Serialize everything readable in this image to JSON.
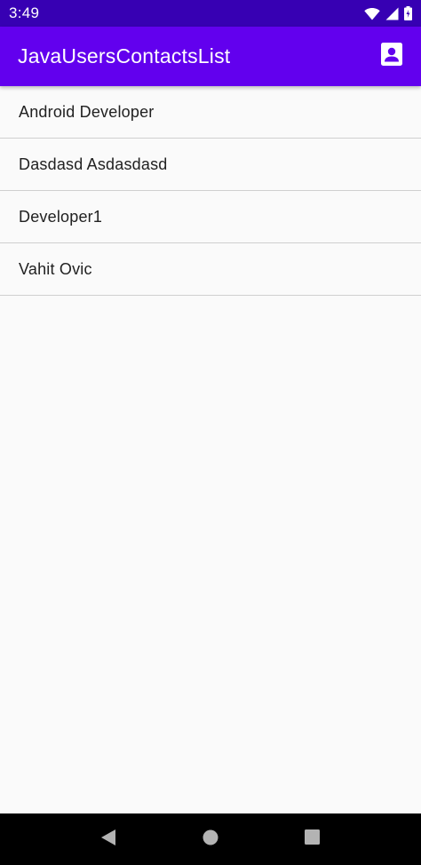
{
  "status_bar": {
    "time": "3:49",
    "icons": [
      "wifi-icon",
      "cellular-signal-icon",
      "battery-icon"
    ]
  },
  "app_bar": {
    "title": "JavaUsersContactsList",
    "action_icon": "contacts-icon",
    "background_color": "#6200ee",
    "status_color": "#3700b3"
  },
  "contacts": [
    {
      "name": "Android Developer"
    },
    {
      "name": "Dasdasd Asdasdasd"
    },
    {
      "name": "Developer1"
    },
    {
      "name": "Vahit Ovic"
    }
  ],
  "nav_bar": {
    "icons": [
      "back-icon",
      "home-icon",
      "recents-icon"
    ]
  }
}
